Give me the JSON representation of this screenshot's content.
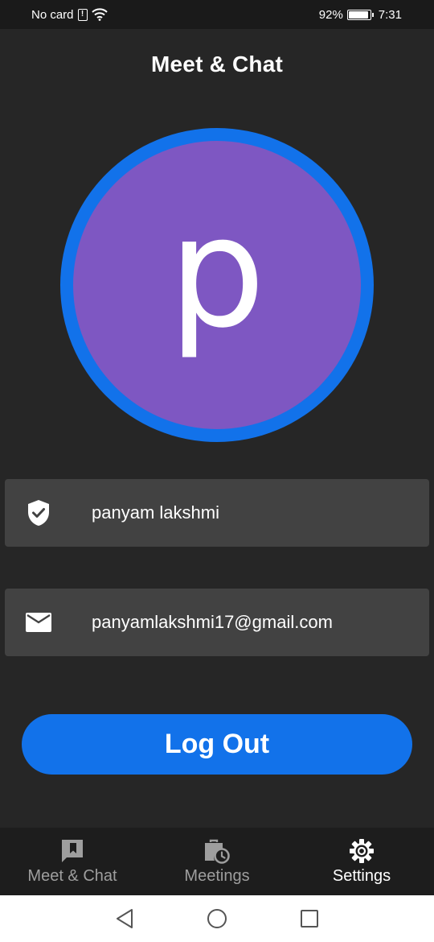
{
  "status_bar": {
    "carrier": "No card",
    "battery_percent": "92%",
    "time": "7:31",
    "battery_level": 0.92
  },
  "app_bar": {
    "title": "Meet & Chat"
  },
  "profile": {
    "avatar_letter": "p",
    "avatar_color": "#7e57c2",
    "ring_color": "#1272ea",
    "name": "panyam lakshmi",
    "name_icon": "verified-shield-icon",
    "email": "panyamlakshmi17@gmail.com",
    "email_icon": "mail-icon"
  },
  "logout": {
    "label": "Log Out",
    "color": "#1272ea"
  },
  "bottom_nav": {
    "items": [
      {
        "label": "Meet & Chat",
        "icon": "bookmark-chat-icon",
        "active": false
      },
      {
        "label": "Meetings",
        "icon": "briefcase-clock-icon",
        "active": false
      },
      {
        "label": "Settings",
        "icon": "gear-icon",
        "active": true
      }
    ]
  },
  "system_nav": {
    "buttons": [
      "back-icon",
      "home-icon",
      "recents-icon"
    ]
  }
}
